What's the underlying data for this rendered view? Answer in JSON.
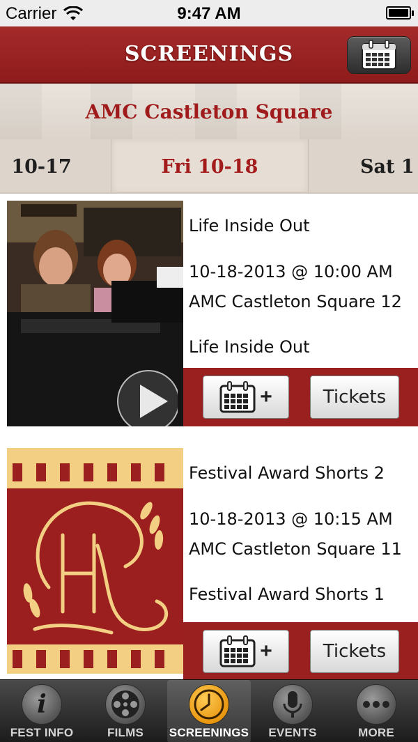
{
  "status_bar": {
    "carrier": "Carrier",
    "time": "9:47 AM",
    "wifi_icon": "wifi-icon",
    "battery_icon": "battery-icon",
    "battery_level": 1.0
  },
  "nav_bar": {
    "title": "SCREENINGS",
    "calendar_button_icon": "calendar-icon"
  },
  "theater": {
    "name": "AMC Castleton Square"
  },
  "date_selector": {
    "previous": "10-17",
    "current": "Fri 10-18",
    "next": "Sat 1"
  },
  "screenings": [
    {
      "title": "Life Inside Out",
      "datetime": "10-18-2013 @ 10:00 AM",
      "venue": "AMC Castleton Square 12",
      "program": "Life Inside Out",
      "has_video": true,
      "add_calendar_icon": "calendar-add-icon",
      "add_calendar_plus": "+",
      "tickets_label": "Tickets"
    },
    {
      "title": "Festival Award Shorts 2",
      "datetime": "10-18-2013 @ 10:15 AM",
      "venue": "AMC Castleton Square 11",
      "program": "Festival Award Shorts 1",
      "has_video": false,
      "add_calendar_icon": "calendar-add-icon",
      "add_calendar_plus": "+",
      "tickets_label": "Tickets"
    }
  ],
  "tab_bar": {
    "tabs": [
      {
        "label": "FEST INFO",
        "icon": "info-icon",
        "selected": false
      },
      {
        "label": "FILMS",
        "icon": "film-reel-icon",
        "selected": false
      },
      {
        "label": "SCREENINGS",
        "icon": "clock-icon",
        "selected": true
      },
      {
        "label": "EVENTS",
        "icon": "microphone-icon",
        "selected": false
      },
      {
        "label": "MORE",
        "icon": "more-icon",
        "selected": false
      }
    ]
  },
  "colors": {
    "brand_red": "#9a1f1f",
    "date_highlight": "#a31b1b",
    "selected_tab_icon": "#e8960f",
    "logo_gold": "#f3cf83"
  }
}
